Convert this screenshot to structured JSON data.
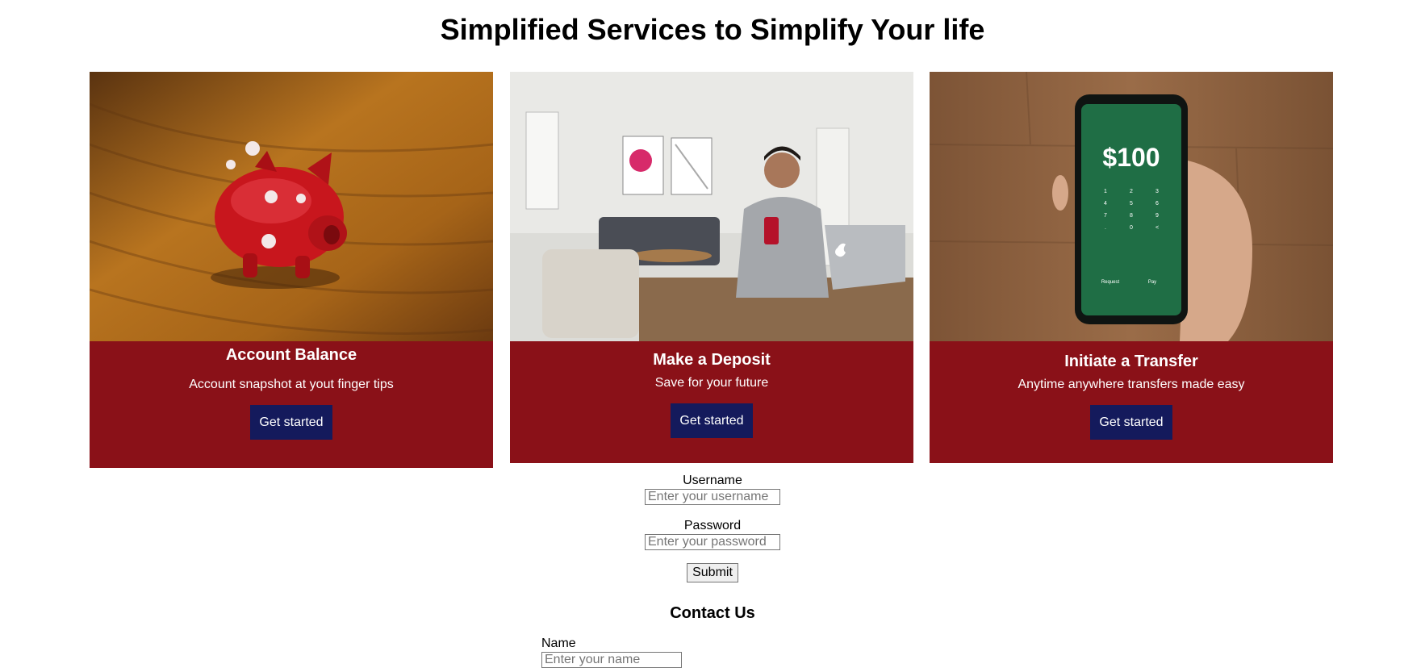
{
  "page": {
    "title": "Simplified Services to Simplify Your life"
  },
  "cards": [
    {
      "title": "Account Balance",
      "description": "Account snapshot at yout finger tips",
      "button": "Get started",
      "image": "piggy-bank-photo"
    },
    {
      "title": "Make a Deposit",
      "description": "Save for your future",
      "button": "Get started",
      "image": "man-with-phone-and-laptop-photo"
    },
    {
      "title": "Initiate a Transfer",
      "description": "Anytime anywhere transfers made easy",
      "button": "Get started",
      "image": "phone-payment-app-photo",
      "phone_amount": "$100",
      "phone_keys": [
        "1",
        "2",
        "3",
        "4",
        "5",
        "6",
        "7",
        "8",
        "9",
        ".",
        "0",
        "<"
      ],
      "phone_request": "Request",
      "phone_pay": "Pay"
    }
  ],
  "login": {
    "username_label": "Username",
    "username_placeholder": "Enter your username",
    "password_label": "Password",
    "password_placeholder": "Enter your password",
    "submit": "Submit"
  },
  "contact": {
    "title": "Contact Us",
    "name_label": "Name",
    "name_placeholder": "Enter your name"
  },
  "colors": {
    "card_background": "#8a1118",
    "button_background": "#141a5c"
  }
}
